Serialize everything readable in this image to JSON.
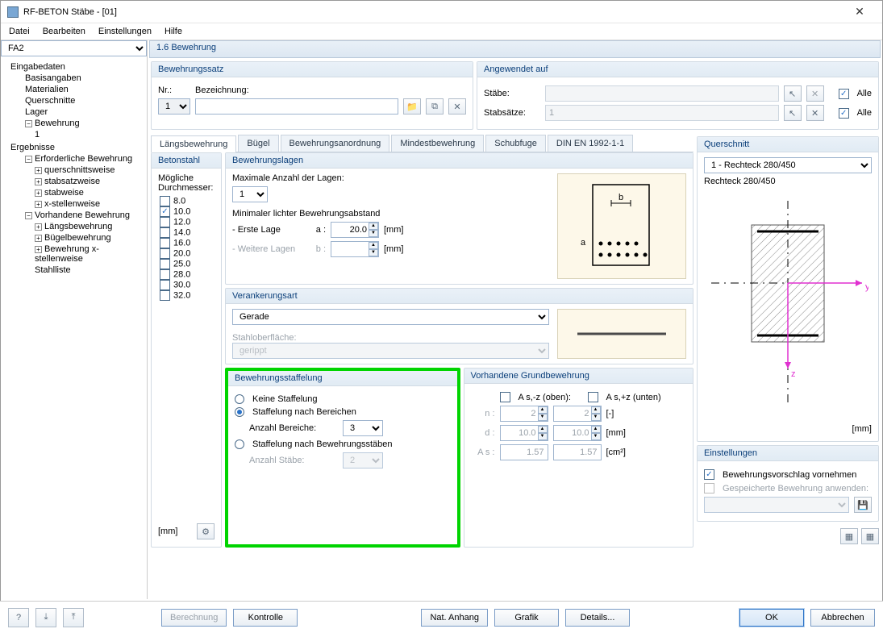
{
  "window": {
    "title": "RF-BETON Stäbe - [01]"
  },
  "menu": {
    "file": "Datei",
    "edit": "Bearbeiten",
    "settings": "Einstellungen",
    "help": "Hilfe"
  },
  "caseSelector": {
    "value": "FA2"
  },
  "tree": {
    "inputs": "Eingabedaten",
    "basisangaben": "Basisangaben",
    "materialien": "Materialien",
    "querschnitte": "Querschnitte",
    "lager": "Lager",
    "bewehrung": "Bewehrung",
    "bew1": "1",
    "ergebnisse": "Ergebnisse",
    "erf": "Erforderliche Bewehrung",
    "qsw": "querschnittsweise",
    "ssw": "stabsatzweise",
    "stw": "stabweise",
    "xsw": "x-stellenweise",
    "vorh": "Vorhandene Bewehrung",
    "langs": "Längsbewehrung",
    "bugel": "Bügelbewehrung",
    "bewx": "Bewehrung x-stellenweise",
    "stahl": "Stahlliste"
  },
  "section": {
    "title": "1.6 Bewehrung"
  },
  "bewSatz": {
    "title": "Bewehrungssatz",
    "nrLabel": "Nr.:",
    "nrValue": "1",
    "bezLabel": "Bezeichnung:",
    "bezValue": ""
  },
  "angewendet": {
    "title": "Angewendet auf",
    "staebe": "Stäbe:",
    "stabsaetze": "Stabsätze:",
    "stabsaetzeVal": "1",
    "alle": "Alle"
  },
  "tabs": {
    "t1": "Längsbewehrung",
    "t2": "Bügel",
    "t3": "Bewehrungsanordnung",
    "t4": "Mindestbewehrung",
    "t5": "Schubfuge",
    "t6": "DIN EN 1992-1-1"
  },
  "betonstahl": {
    "title": "Betonstahl",
    "label": "Mögliche Durchmesser:",
    "d": [
      "8.0",
      "10.0",
      "12.0",
      "14.0",
      "16.0",
      "20.0",
      "25.0",
      "28.0",
      "30.0",
      "32.0"
    ],
    "checked": "10.0"
  },
  "lagen": {
    "title": "Bewehrungslagen",
    "maxLabel": "Maximale Anzahl der Lagen:",
    "maxVal": "1",
    "minAbst": "Minimaler lichter Bewehrungsabstand",
    "erste": "- Erste Lage",
    "ersteSym": "a :",
    "ersteVal": "20.0",
    "weitere": "- Weitere Lagen",
    "weitereSym": "b :",
    "mm": "[mm]"
  },
  "verank": {
    "title": "Verankerungsart",
    "val": "Gerade",
    "surfLabel": "Stahloberfläche:",
    "surfVal": "gerippt"
  },
  "staff": {
    "title": "Bewehrungsstaffelung",
    "opt1": "Keine Staffelung",
    "opt2": "Staffelung nach Bereichen",
    "areasLabel": "Anzahl Bereiche:",
    "areasVal": "3",
    "opt3": "Staffelung nach Bewehrungsstäben",
    "barsLabel": "Anzahl Stäbe:",
    "barsVal": "2"
  },
  "grund": {
    "title": "Vorhandene Grundbewehrung",
    "asOben": "A s,-z (oben):",
    "asUnten": "A s,+z (unten)",
    "nLabel": "n :",
    "dLabel": "d :",
    "asLabel": "A s :",
    "nVal": "2",
    "dVal": "10.0",
    "asVal": "1.57",
    "uDash": "[-]",
    "uMm": "[mm]",
    "uCm2": "[cm²]"
  },
  "qs": {
    "title": "Querschnitt",
    "sel": "1 - Rechteck 280/450",
    "lbl": "Rechteck 280/450",
    "unit": "[mm]"
  },
  "einst": {
    "title": "Einstellungen",
    "opt1": "Bewehrungsvorschlag vornehmen",
    "opt2": "Gespeicherte Bewehrung anwenden:"
  },
  "bottomUnit": "[mm]",
  "footer": {
    "berechnung": "Berechnung",
    "kontrolle": "Kontrolle",
    "nat": "Nat. Anhang",
    "grafik": "Grafik",
    "details": "Details...",
    "ok": "OK",
    "abbrechen": "Abbrechen"
  }
}
